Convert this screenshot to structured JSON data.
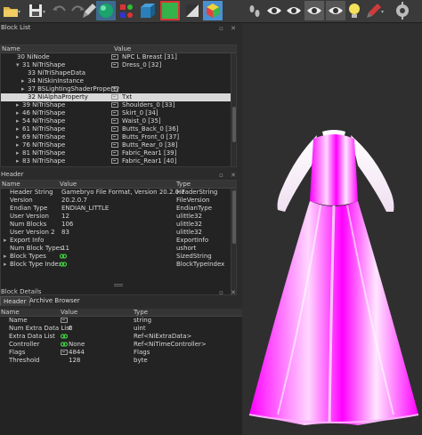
{
  "colors": {
    "accent": "#ff00ff",
    "selection": "#d9d9d9",
    "background": "#2b2b2b"
  },
  "toolbar": {
    "icons": [
      "folder-icon",
      "save-icon",
      "undo-icon",
      "redo-icon",
      "brush-icon",
      "sphere-icon",
      "shapes-icon",
      "cube-icon",
      "green-cube-icon",
      "contrast-icon",
      "color-cube-icon",
      "footprints-icon",
      "eye-icon",
      "eye-icon",
      "eye-settings-icon",
      "eye-icon",
      "light-icon",
      "brush-pen-icon",
      "settings-icon"
    ]
  },
  "block_list": {
    "title": "Block List",
    "columns": [
      "Name",
      "Value"
    ],
    "rows": [
      {
        "indent": 0,
        "arrow": "",
        "name": "30 NiNode",
        "icon": "tag",
        "value": "NPC L Breast [31]"
      },
      {
        "indent": 1,
        "arrow": "▾",
        "name": "31 NiTriShape",
        "icon": "tag",
        "value": "Dress_0 [32]"
      },
      {
        "indent": 2,
        "arrow": "",
        "name": "33 NiTriShapeData",
        "icon": "",
        "value": ""
      },
      {
        "indent": 2,
        "arrow": "▸",
        "name": "34 NiSkinInstance",
        "icon": "",
        "value": ""
      },
      {
        "indent": 2,
        "arrow": "▸",
        "name": "37 BSLightingShaderProperty",
        "icon": "tag",
        "value": ""
      },
      {
        "indent": 2,
        "arrow": "",
        "name": "32 NiAlphaProperty",
        "icon": "tag",
        "value": "Txt",
        "selected": true
      },
      {
        "indent": 1,
        "arrow": "▸",
        "name": "39 NiTriShape",
        "icon": "tag",
        "value": "Shoulders_0 [33]"
      },
      {
        "indent": 1,
        "arrow": "▸",
        "name": "46 NiTriShape",
        "icon": "tag",
        "value": "Skirt_0 [34]"
      },
      {
        "indent": 1,
        "arrow": "▸",
        "name": "54 NiTriShape",
        "icon": "tag",
        "value": "Waist_0 [35]"
      },
      {
        "indent": 1,
        "arrow": "▸",
        "name": "61 NiTriShape",
        "icon": "tag",
        "value": "Butts_Back_0 [36]"
      },
      {
        "indent": 1,
        "arrow": "▸",
        "name": "69 NiTriShape",
        "icon": "tag",
        "value": "Butts_Front_0 [37]"
      },
      {
        "indent": 1,
        "arrow": "▸",
        "name": "76 NiTriShape",
        "icon": "tag",
        "value": "Butts_Rear_0 [38]"
      },
      {
        "indent": 1,
        "arrow": "▸",
        "name": "81 NiTriShape",
        "icon": "tag",
        "value": "Fabric_Rear1 [39]"
      },
      {
        "indent": 1,
        "arrow": "▸",
        "name": "83 NiTriShape",
        "icon": "tag",
        "value": "Fabric_Rear1 [40]"
      }
    ]
  },
  "header": {
    "title": "Header",
    "columns": [
      "Name",
      "Value",
      "Type"
    ],
    "rows": [
      {
        "arrow": "",
        "name": "Header String",
        "value": "Gamebryo File Format, Version 20.2.0.7",
        "type": "HeaderString",
        "icon": ""
      },
      {
        "arrow": "",
        "name": "Version",
        "value": "20.2.0.7",
        "type": "FileVersion",
        "icon": ""
      },
      {
        "arrow": "",
        "name": "Endian Type",
        "value": "ENDIAN_LITTLE",
        "type": "EndianType",
        "icon": ""
      },
      {
        "arrow": "",
        "name": "User Version",
        "value": "12",
        "type": "ulittle32",
        "icon": ""
      },
      {
        "arrow": "",
        "name": "Num Blocks",
        "value": "106",
        "type": "ulittle32",
        "icon": ""
      },
      {
        "arrow": "",
        "name": "User Version 2",
        "value": "83",
        "type": "ulittle32",
        "icon": ""
      },
      {
        "arrow": "▸",
        "name": "Export Info",
        "value": "",
        "type": "ExportInfo",
        "icon": ""
      },
      {
        "arrow": "",
        "name": "Num Block Types",
        "value": "11",
        "type": "ushort",
        "icon": ""
      },
      {
        "arrow": "▸",
        "name": "Block Types",
        "value": "",
        "type": "SizedString",
        "icon": "chain"
      },
      {
        "arrow": "▸",
        "name": "Block Type Index",
        "value": "",
        "type": "BlockTypeIndex",
        "icon": "chain"
      }
    ]
  },
  "tabs": [
    "Header",
    "Archive Browser"
  ],
  "block_details": {
    "title": "Block Details",
    "columns": [
      "Name",
      "Value",
      "Type"
    ],
    "rows": [
      {
        "name": "Name",
        "value": "",
        "type": "string",
        "icon": "tag"
      },
      {
        "name": "Num Extra Data List",
        "value": "0",
        "type": "uint",
        "icon": ""
      },
      {
        "name": "Extra Data List",
        "value": "",
        "type": "Ref<NiExtraData>",
        "icon": "chain"
      },
      {
        "name": "Controller",
        "value": "None",
        "type": "Ref<NiTimeController>",
        "icon": "chain"
      },
      {
        "name": "Flags",
        "value": "4844",
        "type": "Flags",
        "icon": "tag"
      },
      {
        "name": "Threshold",
        "value": "128",
        "type": "byte",
        "icon": ""
      }
    ]
  }
}
